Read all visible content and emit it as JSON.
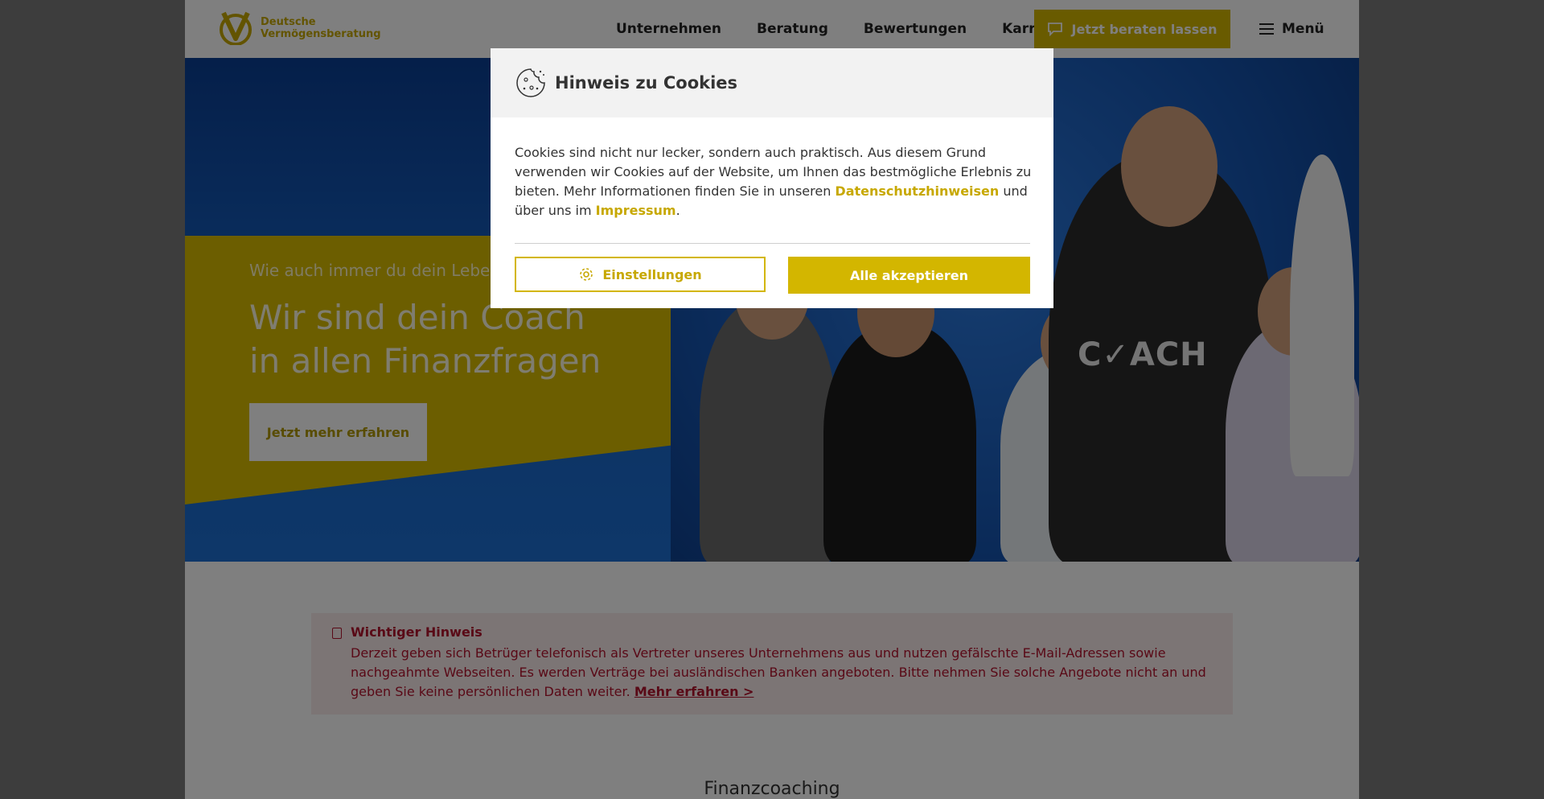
{
  "header": {
    "logo_line1": "Deutsche",
    "logo_line2": "Vermögensberatung",
    "nav": [
      "Unternehmen",
      "Beratung",
      "Bewertungen",
      "Karriere"
    ],
    "cta_label": "Jetzt beraten lassen",
    "menu_label": "Menü"
  },
  "hero": {
    "subtitle": "Wie auch immer du dein Leben le",
    "title": "Wir sind dein Coach in allen Finanzfragen",
    "button_label": "Jetzt mehr erfahren",
    "shirt_text": "C✓ACH"
  },
  "warning": {
    "title": "Wichtiger Hinweis",
    "body": "Derzeit geben sich Betrüger telefonisch als Vertreter unseres Unternehmens aus und nutzen gefälschte E-Mail-Adressen sowie nachgeahmte Webseiten. Es werden Verträge bei ausländischen Banken angeboten. Bitte nehmen Sie solche Angebote nicht an und geben Sie keine persönlichen Daten weiter.",
    "link": "Mehr erfahren >"
  },
  "section": {
    "heading": "Finanzcoaching"
  },
  "cookie_modal": {
    "title": "Hinweis zu Cookies",
    "body_part1": "Cookies sind nicht nur lecker, sondern auch praktisch. Aus diesem Grund verwenden wir Cookies auf der Website, um Ihnen das bestmögliche Erlebnis zu bieten. Mehr Informationen finden Sie in unseren ",
    "link_privacy": "Datenschutzhinweisen",
    "body_part2": " und über uns im ",
    "link_imprint": "Impressum",
    "body_part3": ".",
    "settings_label": "Einstellungen",
    "accept_label": "Alle akzeptieren"
  },
  "colors": {
    "brand_yellow": "#d3b600",
    "warning_red": "#b3122d",
    "hero_blue": "#1763c5"
  }
}
